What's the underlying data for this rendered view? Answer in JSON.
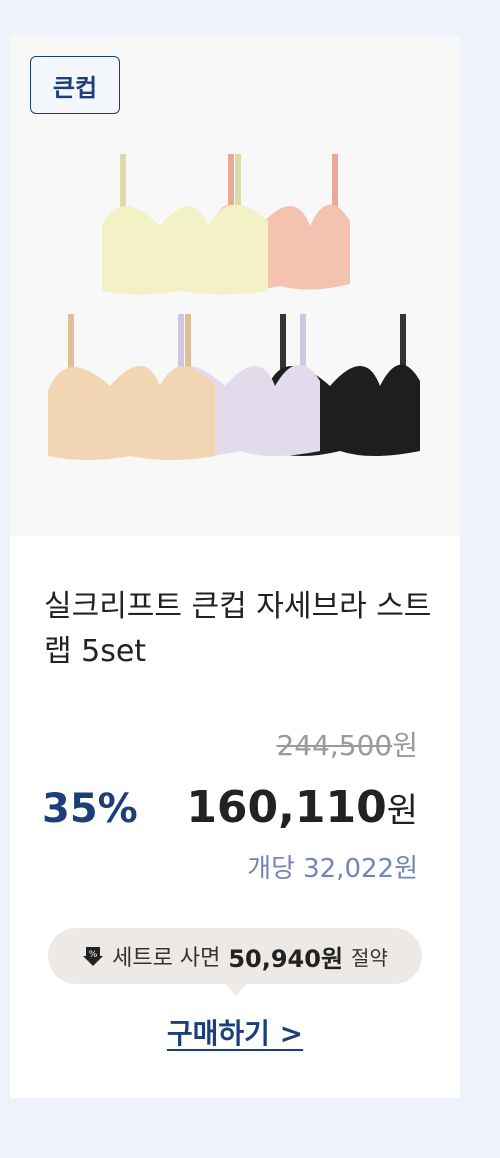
{
  "product": {
    "badge": "큰컵",
    "title": "실크리프트 큰컵 자세브라 스트랩 5set",
    "original_price": "244,500",
    "currency": "원",
    "discount_rate": "35%",
    "sale_price": "160,110",
    "unit_price_label": "개당",
    "unit_price": "32,022원",
    "image_colors": [
      "#f3f1c6",
      "#f3c3b0",
      "#f2d6b4",
      "#e2dbec",
      "#1e1e1e"
    ]
  },
  "savings": {
    "icon": "discount-arrow-down-icon",
    "prefix": "세트로 사면",
    "amount": "50,940원",
    "suffix": "절약"
  },
  "cta": {
    "buy_label": "구매하기 >"
  }
}
